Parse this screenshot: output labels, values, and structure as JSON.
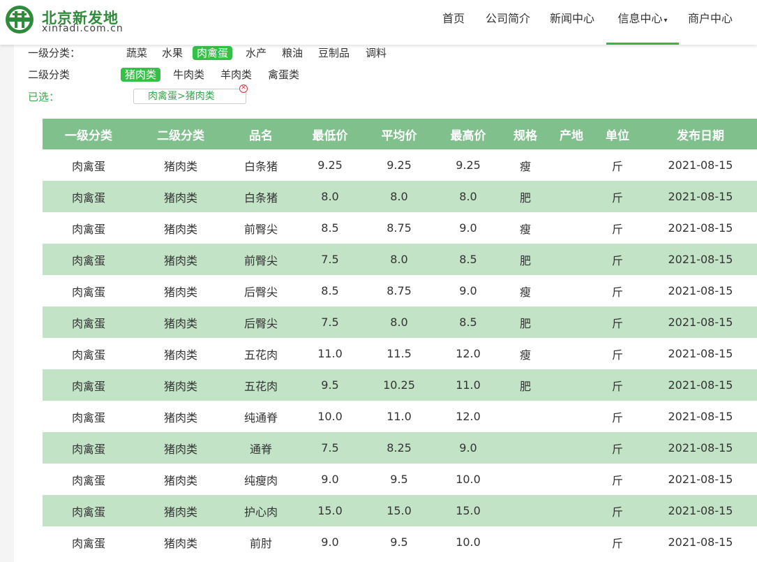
{
  "logo": {
    "cn": "北京新发地",
    "en": "xinfadi.com.cn"
  },
  "nav": {
    "items": [
      {
        "label": "首页",
        "active": false
      },
      {
        "label": "公司简介",
        "active": false
      },
      {
        "label": "新闻中心",
        "active": false
      },
      {
        "label": "信息中心",
        "active": true,
        "dropdown": true
      },
      {
        "label": "商户中心",
        "active": false
      }
    ]
  },
  "filters": {
    "level1": {
      "label": "一级分类：",
      "options": [
        "蔬菜",
        "水果",
        "肉禽蛋",
        "水产",
        "粮油",
        "豆制品",
        "调料"
      ],
      "selected": "肉禽蛋"
    },
    "level2": {
      "label": "二级分类",
      "options": [
        "猪肉类",
        "牛肉类",
        "羊肉类",
        "禽蛋类"
      ],
      "selected": "猪肉类"
    },
    "chosen": {
      "label": "已选：",
      "value": "肉禽蛋>猪肉类"
    }
  },
  "table": {
    "headers": [
      "一级分类",
      "二级分类",
      "品名",
      "最低价",
      "平均价",
      "最高价",
      "规格",
      "产地",
      "单位",
      "发布日期"
    ],
    "rows": [
      [
        "肉禽蛋",
        "猪肉类",
        "白条猪",
        "9.25",
        "9.25",
        "9.25",
        "瘦",
        "",
        "斤",
        "2021-08-15"
      ],
      [
        "肉禽蛋",
        "猪肉类",
        "白条猪",
        "8.0",
        "8.0",
        "8.0",
        "肥",
        "",
        "斤",
        "2021-08-15"
      ],
      [
        "肉禽蛋",
        "猪肉类",
        "前臀尖",
        "8.5",
        "8.75",
        "9.0",
        "瘦",
        "",
        "斤",
        "2021-08-15"
      ],
      [
        "肉禽蛋",
        "猪肉类",
        "前臀尖",
        "7.5",
        "8.0",
        "8.5",
        "肥",
        "",
        "斤",
        "2021-08-15"
      ],
      [
        "肉禽蛋",
        "猪肉类",
        "后臀尖",
        "8.5",
        "8.75",
        "9.0",
        "瘦",
        "",
        "斤",
        "2021-08-15"
      ],
      [
        "肉禽蛋",
        "猪肉类",
        "后臀尖",
        "7.5",
        "8.0",
        "8.5",
        "肥",
        "",
        "斤",
        "2021-08-15"
      ],
      [
        "肉禽蛋",
        "猪肉类",
        "五花肉",
        "11.0",
        "11.5",
        "12.0",
        "瘦",
        "",
        "斤",
        "2021-08-15"
      ],
      [
        "肉禽蛋",
        "猪肉类",
        "五花肉",
        "9.5",
        "10.25",
        "11.0",
        "肥",
        "",
        "斤",
        "2021-08-15"
      ],
      [
        "肉禽蛋",
        "猪肉类",
        "纯通脊",
        "10.0",
        "11.0",
        "12.0",
        "",
        "",
        "斤",
        "2021-08-15"
      ],
      [
        "肉禽蛋",
        "猪肉类",
        "通脊",
        "7.5",
        "8.25",
        "9.0",
        "",
        "",
        "斤",
        "2021-08-15"
      ],
      [
        "肉禽蛋",
        "猪肉类",
        "纯瘦肉",
        "9.0",
        "9.5",
        "10.0",
        "",
        "",
        "斤",
        "2021-08-15"
      ],
      [
        "肉禽蛋",
        "猪肉类",
        "护心肉",
        "15.0",
        "15.0",
        "15.0",
        "",
        "",
        "斤",
        "2021-08-15"
      ],
      [
        "肉禽蛋",
        "猪肉类",
        "前肘",
        "9.0",
        "9.5",
        "10.0",
        "",
        "",
        "斤",
        "2021-08-15"
      ]
    ]
  },
  "colors": {
    "brand_green": "#35c04a",
    "table_header": "#80c08c",
    "row_alt": "#c3e3c7"
  }
}
